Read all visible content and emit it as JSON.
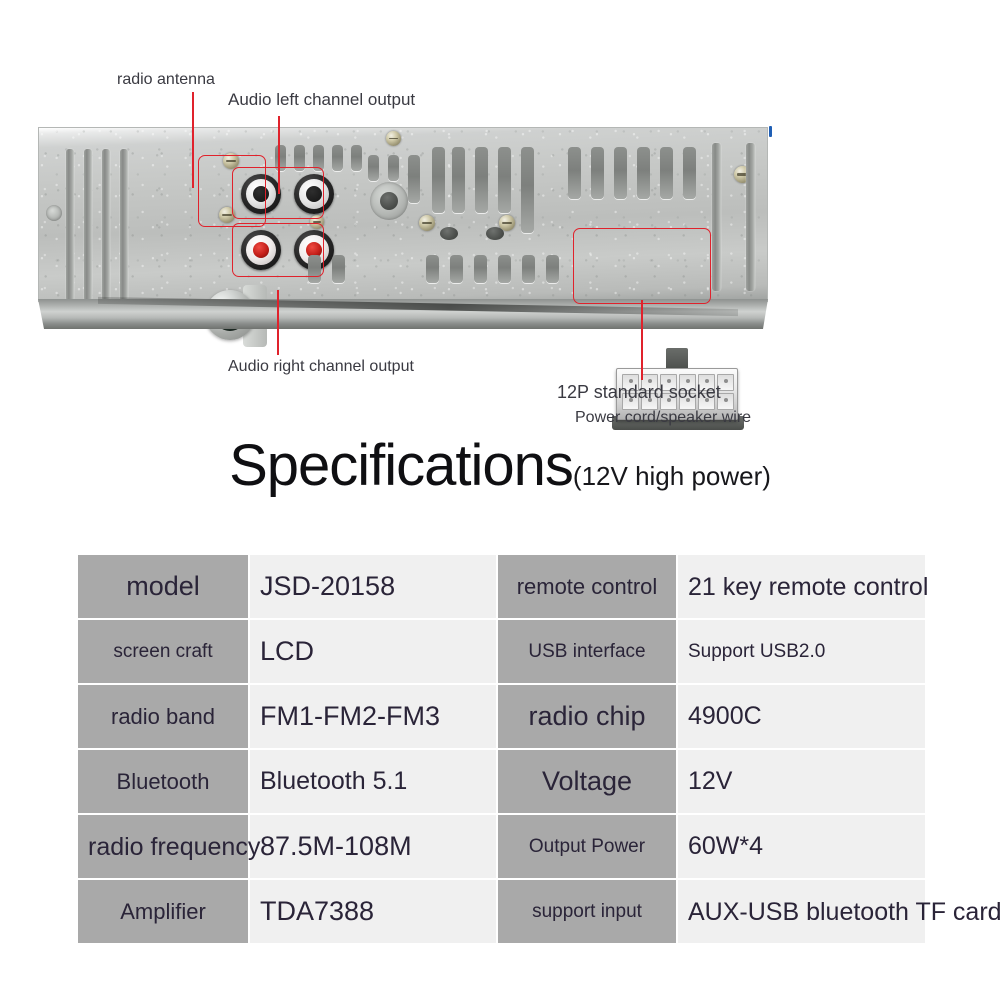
{
  "photo": {
    "alt": "rear panel of 1-din car stereo head unit",
    "annotations": [
      {
        "id": "radio-antenna",
        "label": "radio antenna"
      },
      {
        "id": "audio-left",
        "label": "Audio left channel output"
      },
      {
        "id": "audio-right",
        "label": "Audio right channel output"
      },
      {
        "id": "socket-12p",
        "label": "12P standard socket"
      },
      {
        "id": "socket-12p-sub",
        "label": "Power cord/speaker wire"
      }
    ],
    "accent_color": "#e0222c"
  },
  "title": {
    "main": "Specifications",
    "sub": "(12V high power)"
  },
  "spec_table": {
    "rows": [
      {
        "k1": "model",
        "v1": "JSD-20158",
        "k2": "remote control",
        "v2": "21 key remote control"
      },
      {
        "k1": "screen craft",
        "v1": "LCD",
        "k2": "USB interface",
        "v2": "Support USB2.0"
      },
      {
        "k1": "radio band",
        "v1": "FM1-FM2-FM3",
        "k2": "radio chip",
        "v2": "4900C"
      },
      {
        "k1": "Bluetooth",
        "v1": "Bluetooth 5.1",
        "k2": "Voltage",
        "v2": "12V"
      },
      {
        "k1": "radio frequency",
        "v1": "87.5M-108M",
        "k2": "Output Power",
        "v2": "60W*4"
      },
      {
        "k1": "Amplifier",
        "v1": "TDA7388",
        "k2": "support input",
        "v2": "AUX-USB bluetooth TF card"
      }
    ],
    "key_bg": "#a9a9a9",
    "val_bg": "#f0f0f0"
  }
}
